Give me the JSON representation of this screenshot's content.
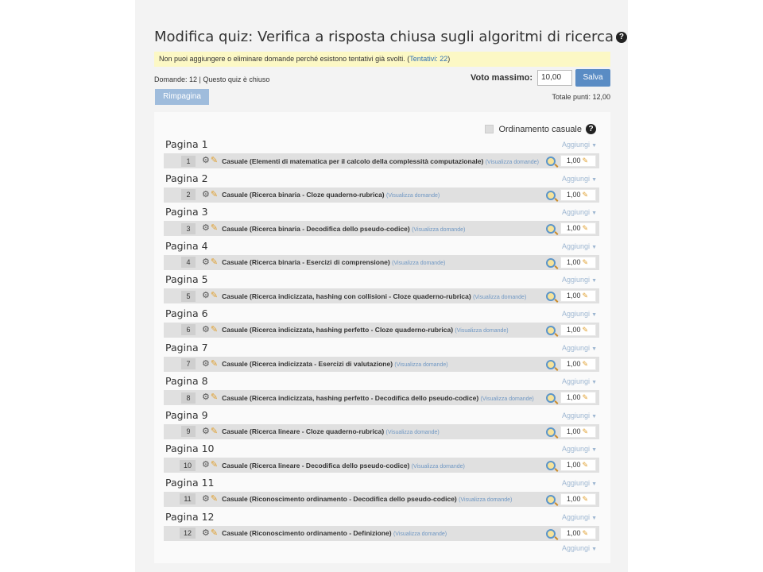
{
  "title": "Modifica quiz: Verifica a risposta chiusa sugli algoritmi di ricerca",
  "help_glyph": "?",
  "notice": {
    "text": "Non puoi aggiungere o eliminare domande perché esistono tentativi già svolti. (",
    "link": "Tentativi: 22",
    "close": ")"
  },
  "info_line": "Domande: 12 | Questo quiz è chiuso",
  "maxgrade": {
    "label": "Voto massimo:",
    "value": "10,00",
    "save_label": "Salva"
  },
  "repaginate_label": "Rimpagina",
  "total_points": "Totale punti: 12,00",
  "shuffle_label": "Ordinamento casuale",
  "add_label": "Aggiungi",
  "view_label": "(Visualizza domande)",
  "icons": {
    "gear": "gear-icon",
    "pencil": "pencil-icon",
    "preview": "magnifier-icon",
    "caret": "caret-down-icon"
  },
  "colors": {
    "notice_bg": "#fcf8c5",
    "save_button": "#5a8cc4",
    "repaginate_button": "#9fbcdc",
    "link": "#2f6fb3",
    "pencil": "#e0a030"
  },
  "pages": [
    {
      "label": "Pagina 1",
      "num": "1",
      "text": "Casuale (Elementi di matematica per il calcolo della complessità computazionale)",
      "view": "(Visualizza domande)",
      "mark": "1,00"
    },
    {
      "label": "Pagina 2",
      "num": "2",
      "text": "Casuale (Ricerca binaria - Cloze quaderno-rubrica)",
      "view": "(Visualizza domande)",
      "mark": "1,00"
    },
    {
      "label": "Pagina 3",
      "num": "3",
      "text": "Casuale (Ricerca binaria - Decodifica dello pseudo-codice)",
      "view": "(Visualizza domande)",
      "mark": "1,00"
    },
    {
      "label": "Pagina 4",
      "num": "4",
      "text": "Casuale (Ricerca binaria - Esercizi di comprensione)",
      "view": "(Visualizza domande)",
      "mark": "1,00"
    },
    {
      "label": "Pagina 5",
      "num": "5",
      "text": "Casuale (Ricerca indicizzata, hashing con collisioni - Cloze quaderno-rubrica)",
      "view": "(Visualizza domande)",
      "mark": "1,00"
    },
    {
      "label": "Pagina 6",
      "num": "6",
      "text": "Casuale (Ricerca indicizzata, hashing perfetto - Cloze quaderno-rubrica)",
      "view": "(Visualizza domande)",
      "mark": "1,00"
    },
    {
      "label": "Pagina 7",
      "num": "7",
      "text": "Casuale (Ricerca indicizzata - Esercizi di valutazione)",
      "view": "(Visualizza domande)",
      "mark": "1,00"
    },
    {
      "label": "Pagina 8",
      "num": "8",
      "text": "Casuale (Ricerca indicizzata, hashing perfetto - Decodifica dello pseudo-codice)",
      "view": "(Visualizza domande)",
      "mark": "1,00"
    },
    {
      "label": "Pagina 9",
      "num": "9",
      "text": "Casuale (Ricerca lineare - Cloze quaderno-rubrica)",
      "view": "(Visualizza domande)",
      "mark": "1,00"
    },
    {
      "label": "Pagina 10",
      "num": "10",
      "text": "Casuale (Ricerca lineare - Decodifica dello pseudo-codice)",
      "view": "(Visualizza domande)",
      "mark": "1,00"
    },
    {
      "label": "Pagina 11",
      "num": "11",
      "text": "Casuale (Riconoscimento ordinamento - Decodifica dello pseudo-codice)",
      "view": "(Visualizza domande)",
      "mark": "1,00"
    },
    {
      "label": "Pagina 12",
      "num": "12",
      "text": "Casuale (Riconoscimento ordinamento - Definizione)",
      "view": "(Visualizza domande)",
      "mark": "1,00"
    }
  ]
}
